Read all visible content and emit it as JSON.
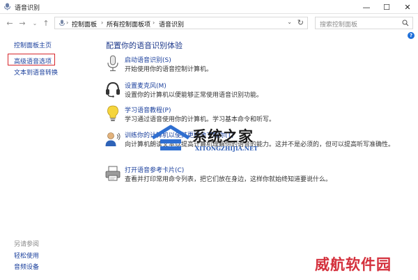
{
  "window": {
    "title": "语音识别",
    "minimize_label": "—",
    "maximize_label": "☐",
    "close_label": "✕"
  },
  "address_bar": {
    "breadcrumbs": [
      "控制面板",
      "所有控制面板项",
      "语音识别"
    ],
    "search_placeholder": "搜索控制面板"
  },
  "sidebar": {
    "links": [
      {
        "label": "控制面板主页"
      },
      {
        "label": "高级语音选项"
      },
      {
        "label": "文本到语音转换"
      }
    ],
    "see_also": {
      "heading": "另请参阅",
      "links": [
        {
          "label": "轻松使用"
        },
        {
          "label": "音频设备"
        }
      ]
    }
  },
  "main": {
    "title": "配置你的语音识别体验",
    "tasks": [
      {
        "icon": "microphone-icon",
        "link": "启动语音识别(S)",
        "desc": "开始使用你的语音控制计算机。"
      },
      {
        "icon": "headset-icon",
        "link": "设置麦克风(M)",
        "desc": "设置你的计算机以便能够正常使用语音识别功能。"
      },
      {
        "icon": "lightbulb-icon",
        "link": "学习语音教程(P)",
        "desc": "学习通过语音使用你的计算机。学习基本命令和听写。"
      },
      {
        "icon": "user-speech-icon",
        "link": "训练你的计算机以使其更好地了解你(T)",
        "desc": "向计算机朗读文本以提高计算机理解你的语音的能力。这并不是必须的，但可以提高听写准确性。"
      },
      {
        "icon": "printer-icon",
        "link": "打开语音参考卡片(C)",
        "desc": "查看并打印常用命令列表，把它们放在身边，这样你就始终知道要说什么。"
      }
    ]
  },
  "watermarks": {
    "site_name": "系统之家",
    "site_domain": "XITONGZHIJIA.NET",
    "corner_mark": "威航软件园"
  }
}
